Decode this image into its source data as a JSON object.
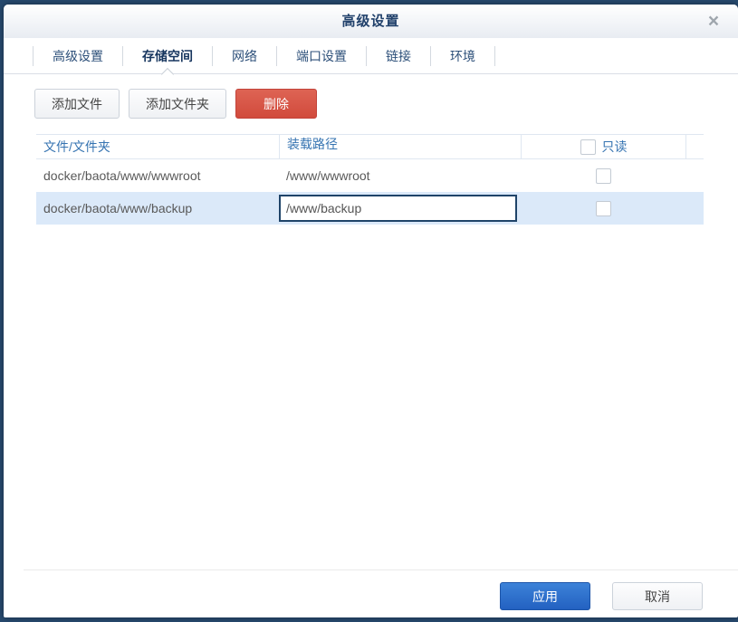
{
  "dialog": {
    "title": "高级设置",
    "close_glyph": "×"
  },
  "tabs": [
    {
      "label": "高级设置",
      "active": false
    },
    {
      "label": "存储空间",
      "active": true
    },
    {
      "label": "网络",
      "active": false
    },
    {
      "label": "端口设置",
      "active": false
    },
    {
      "label": "链接",
      "active": false
    },
    {
      "label": "环境",
      "active": false
    }
  ],
  "toolbar": {
    "add_file_label": "添加文件",
    "add_folder_label": "添加文件夹",
    "delete_label": "删除"
  },
  "table": {
    "headers": {
      "file": "文件/文件夹",
      "mount": "装载路径",
      "readonly": "只读"
    },
    "header_readonly_checkbox_checked": false,
    "rows": [
      {
        "file": "docker/baota/www/wwwroot",
        "mount": "/www/wwwroot",
        "readonly_checked": false,
        "selected": false,
        "editing": false
      },
      {
        "file": "docker/baota/www/backup",
        "mount": "/www/backup",
        "readonly_checked": false,
        "selected": true,
        "editing": true
      }
    ]
  },
  "footer": {
    "apply_label": "应用",
    "cancel_label": "取消"
  },
  "colors": {
    "backdrop_navy": "#27496e",
    "accent_blue": "#2361c1",
    "danger_red": "#d14a3c",
    "selection_blue": "#dbe9f9",
    "header_text_blue": "#3573b1",
    "title_navy": "#21416b"
  }
}
